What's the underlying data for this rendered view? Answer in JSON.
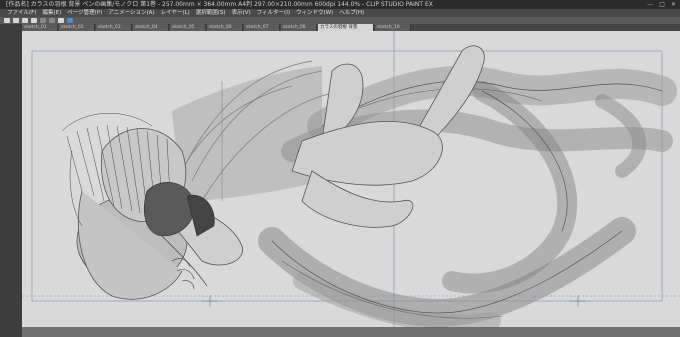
{
  "window": {
    "title": "[作品名] カラスの羽根 背景  ペンの画集/モノクロ 第1巻 - 257.00mm × 364.00mm A4判 297.00×210.00mm 600dpi 144.0% - CLIP STUDIO PAINT EX",
    "controls": [
      "—",
      "□",
      "✕"
    ]
  },
  "menu": {
    "items": [
      "ファイル(F)",
      "編集(E)",
      "ページ管理(P)",
      "アニメーション(A)",
      "レイヤー(L)",
      "選択範囲(S)",
      "表示(V)",
      "フィルター(I)",
      "ウィンドウ(W)",
      "ヘルプ(H)"
    ]
  },
  "tabs": [
    {
      "label": "sketch_01"
    },
    {
      "label": "sketch_02"
    },
    {
      "label": "sketch_03"
    },
    {
      "label": "sketch_04"
    },
    {
      "label": "sketch_05"
    },
    {
      "label": "sketch_06"
    },
    {
      "label": "sketch_07"
    },
    {
      "label": "sketch_08"
    },
    {
      "label": "カラスの羽根 背景"
    },
    {
      "label": "sketch_10"
    }
  ],
  "colors": {
    "ui_dark": "#3b3b3b",
    "paper": "#d9d9d9",
    "guide_line": "#6b8fb8",
    "active_icon": "#4a8cd8"
  },
  "icons": [
    "eye-icon",
    "new-icon",
    "open-icon",
    "save-icon",
    "undo-icon",
    "redo-icon",
    "transform-icon",
    "snap-icon"
  ]
}
